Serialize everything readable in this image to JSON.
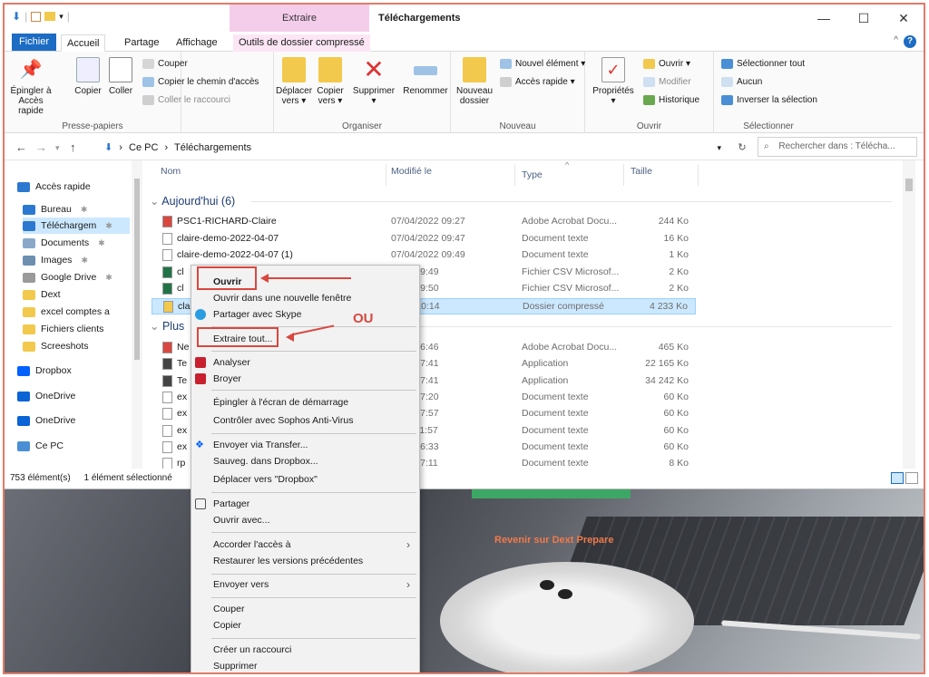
{
  "window": {
    "title": "Téléchargements",
    "context_tab_label": "Extraire",
    "controls": [
      "—",
      "☐",
      "✕"
    ]
  },
  "tabs": {
    "file": "Fichier",
    "home": "Accueil",
    "share": "Partage",
    "view": "Affichage",
    "tools": "Outils de dossier compressé"
  },
  "ribbon": {
    "pin": "Épingler à\nAccès rapide",
    "pin_l1": "Épingler à",
    "pin_l2": "Accès rapide",
    "copy": "Copier",
    "paste": "Coller",
    "cut": "Couper",
    "copy_path": "Copier le chemin d'accès",
    "paste_shortcut": "Coller le raccourci",
    "group_clipboard": "Presse-papiers",
    "move_l1": "Déplacer",
    "move_l2": "vers ▾",
    "copyto_l1": "Copier",
    "copyto_l2": "vers ▾",
    "delete": "Supprimer",
    "delete_l2": "▾",
    "rename": "Renommer",
    "group_organize": "Organiser",
    "newfolder_l1": "Nouveau",
    "newfolder_l2": "dossier",
    "new_item": "Nouvel élément ▾",
    "quick_access": "Accès rapide ▾",
    "group_new": "Nouveau",
    "properties": "Propriétés",
    "properties_l2": "▾",
    "open": "Ouvrir ▾",
    "modify": "Modifier",
    "history": "Historique",
    "group_open": "Ouvrir",
    "select_all": "Sélectionner tout",
    "select_none": "Aucun",
    "invert": "Inverser la sélection",
    "group_select": "Sélectionner"
  },
  "address": {
    "path_root": "Ce PC",
    "path_sep": "›",
    "path_leaf": "Téléchargements",
    "search_placeholder": "Rechercher dans : Télécha..."
  },
  "nav": [
    {
      "label": "Accès rapide",
      "icon": "star-icon",
      "color": "#2b78d0",
      "pin": false
    },
    {
      "label": "Bureau",
      "icon": "desktop-icon",
      "color": "#2b78d0",
      "pin": true
    },
    {
      "label": "Téléchargem",
      "icon": "download-icon",
      "color": "#2b78d0",
      "pin": true
    },
    {
      "label": "Documents",
      "icon": "documents-icon",
      "color": "#8aa9c9",
      "pin": true
    },
    {
      "label": "Images",
      "icon": "images-icon",
      "color": "#6d8fb0",
      "pin": true
    },
    {
      "label": "Google Drive",
      "icon": "drive-icon",
      "color": "#9a9a9a",
      "pin": true
    },
    {
      "label": "Dext",
      "icon": "folder-icon",
      "color": "#f2c94c",
      "pin": false
    },
    {
      "label": "excel comptes a",
      "icon": "folder-icon",
      "color": "#f2c94c",
      "pin": false
    },
    {
      "label": "Fichiers clients",
      "icon": "folder-icon",
      "color": "#f2c94c",
      "pin": false
    },
    {
      "label": "Screeshots",
      "icon": "folder-icon",
      "color": "#f2c94c",
      "pin": false
    },
    {
      "label": "Dropbox",
      "icon": "dropbox-icon",
      "color": "#0061fe",
      "pin": false
    },
    {
      "label": "OneDrive",
      "icon": "onedrive-icon",
      "color": "#0a64d6",
      "pin": false
    },
    {
      "label": "OneDrive",
      "icon": "onedrive-icon",
      "color": "#0a64d6",
      "pin": false
    },
    {
      "label": "Ce PC",
      "icon": "pc-icon",
      "color": "#4a8fd6",
      "pin": false
    }
  ],
  "columns": {
    "name": "Nom",
    "modified": "Modifié le",
    "type": "Type",
    "size": "Taille"
  },
  "groups": {
    "today": "Aujourd'hui (6)",
    "earlier": "Plus"
  },
  "files_today": [
    {
      "name": "PSC1-RICHARD-Claire",
      "date": "07/04/2022 09:27",
      "type": "Adobe Acrobat Docu...",
      "size": "244 Ko",
      "icon": "pdf-icon"
    },
    {
      "name": "claire-demo-2022-04-07",
      "date": "07/04/2022 09:47",
      "type": "Document texte",
      "size": "16 Ko",
      "icon": "text-file-icon"
    },
    {
      "name": "claire-demo-2022-04-07 (1)",
      "date": "07/04/2022 09:49",
      "type": "Document texte",
      "size": "1 Ko",
      "icon": "text-file-icon"
    },
    {
      "name": "cl",
      "date": "2022 09:49",
      "type": "Fichier CSV Microsof...",
      "size": "2 Ko",
      "icon": "csv-icon"
    },
    {
      "name": "cl",
      "date": "2022 09:50",
      "type": "Fichier CSV Microsof...",
      "size": "2 Ko",
      "icon": "csv-icon"
    },
    {
      "name": "cla",
      "date": "2022 10:14",
      "type": "Dossier compressé",
      "size": "4 233 Ko",
      "icon": "zip-icon"
    }
  ],
  "files_earlier": [
    {
      "name": "Ne",
      "date": "2022 16:46",
      "type": "Adobe Acrobat Docu...",
      "size": "465 Ko",
      "icon": "pdf-icon"
    },
    {
      "name": "Te",
      "date": "2022 17:41",
      "type": "Application",
      "size": "22 165 Ko",
      "icon": "app-icon"
    },
    {
      "name": "Te",
      "date": "2022 17:41",
      "type": "Application",
      "size": "34 242 Ko",
      "icon": "app-icon"
    },
    {
      "name": "ex",
      "date": "2022 17:20",
      "type": "Document texte",
      "size": "60 Ko",
      "icon": "text-file-icon"
    },
    {
      "name": "ex",
      "date": "2022 17:57",
      "type": "Document texte",
      "size": "60 Ko",
      "icon": "text-file-icon"
    },
    {
      "name": "ex",
      "date": "2022 11:57",
      "type": "Document texte",
      "size": "60 Ko",
      "icon": "text-file-icon"
    },
    {
      "name": "ex",
      "date": "2022 16:33",
      "type": "Document texte",
      "size": "60 Ko",
      "icon": "text-file-icon"
    },
    {
      "name": "rp",
      "date": "2022 17:11",
      "type": "Document texte",
      "size": "8 Ko",
      "icon": "text-file-icon"
    }
  ],
  "status": {
    "count": "753 élément(s)",
    "selected": "1 élément sélectionné"
  },
  "context_menu": {
    "open": "Ouvrir",
    "open_new_window": "Ouvrir dans une nouvelle fenêtre",
    "share_skype": "Partager avec Skype",
    "extract_all": "Extraire tout...",
    "analyze": "Analyser",
    "shred": "Broyer",
    "pin_start": "Épingler à l'écran de démarrage",
    "sophos": "Contrôler avec Sophos Anti-Virus",
    "transfer": "Envoyer via Transfer...",
    "save_dropbox": "Sauveg. dans Dropbox...",
    "move_dropbox": "Déplacer vers \"Dropbox\"",
    "share": "Partager",
    "open_with": "Ouvrir avec...",
    "grant_access": "Accorder l'accès à",
    "restore": "Restaurer les versions précédentes",
    "send_to": "Envoyer vers",
    "cut": "Couper",
    "copy": "Copier",
    "create_shortcut": "Créer un raccourci",
    "delete": "Supprimer"
  },
  "annotation": {
    "ou": "OU"
  },
  "background": {
    "link": "Revenir sur Dext Prepare"
  }
}
